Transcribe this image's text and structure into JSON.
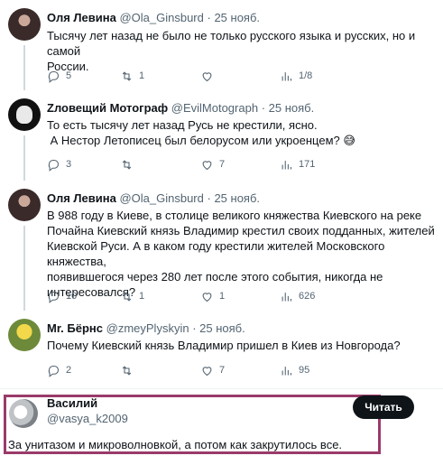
{
  "tweets": [
    {
      "name": "Оля Левина",
      "handle": "@Ola_Ginsburd",
      "date": "25 нояб.",
      "lines": [
        "Тысячу лет назад не было не только русского языка и русских, но и самой",
        "России."
      ],
      "replies": "5",
      "retweets": "1",
      "likes": "",
      "views": "1/8"
    },
    {
      "name": "Zловещий Мотограф",
      "handle": "@EvilMotograph",
      "date": "25 нояб.",
      "lines": [
        "То есть тысячу лет назад Русь не крестили, ясно.",
        " А Нестор Летописец был белорусом или укроенцем? 😅"
      ],
      "replies": "3",
      "retweets": "",
      "likes": "7",
      "views": "171"
    },
    {
      "name": "Оля Левина",
      "handle": "@Ola_Ginsburd",
      "date": "25 нояб.",
      "lines": [
        "В 988 году в Киеве, в столице великого княжества Киевского на реке",
        "Почайна Киевский князь Владимир крестил своих подданных, жителей",
        "Киевской Руси. А в каком году крестили жителей Московского княжества,",
        "появившегося через 280 лет после этого события, никогда не",
        "интересовался?"
      ],
      "replies": "10",
      "retweets": "1",
      "likes": "1",
      "views": "626"
    },
    {
      "name": "Mr. Бёрнс",
      "handle": "@zmeyPlyskyin",
      "date": "25 нояб.",
      "lines": [
        "Почему Киевский князь Владимир пришел в Киев из Новгорода?"
      ],
      "replies": "2",
      "retweets": "",
      "likes": "7",
      "views": "95"
    }
  ],
  "reply": {
    "name": "Василий",
    "handle": "@vasya_k2009",
    "text": "За унитазом и микроволновкой, а потом как закрутилось все.",
    "read_button": "Читать"
  },
  "separator": "·",
  "colors": {
    "highlight_border": "#9b3a6a",
    "secondary_text": "#536471"
  }
}
